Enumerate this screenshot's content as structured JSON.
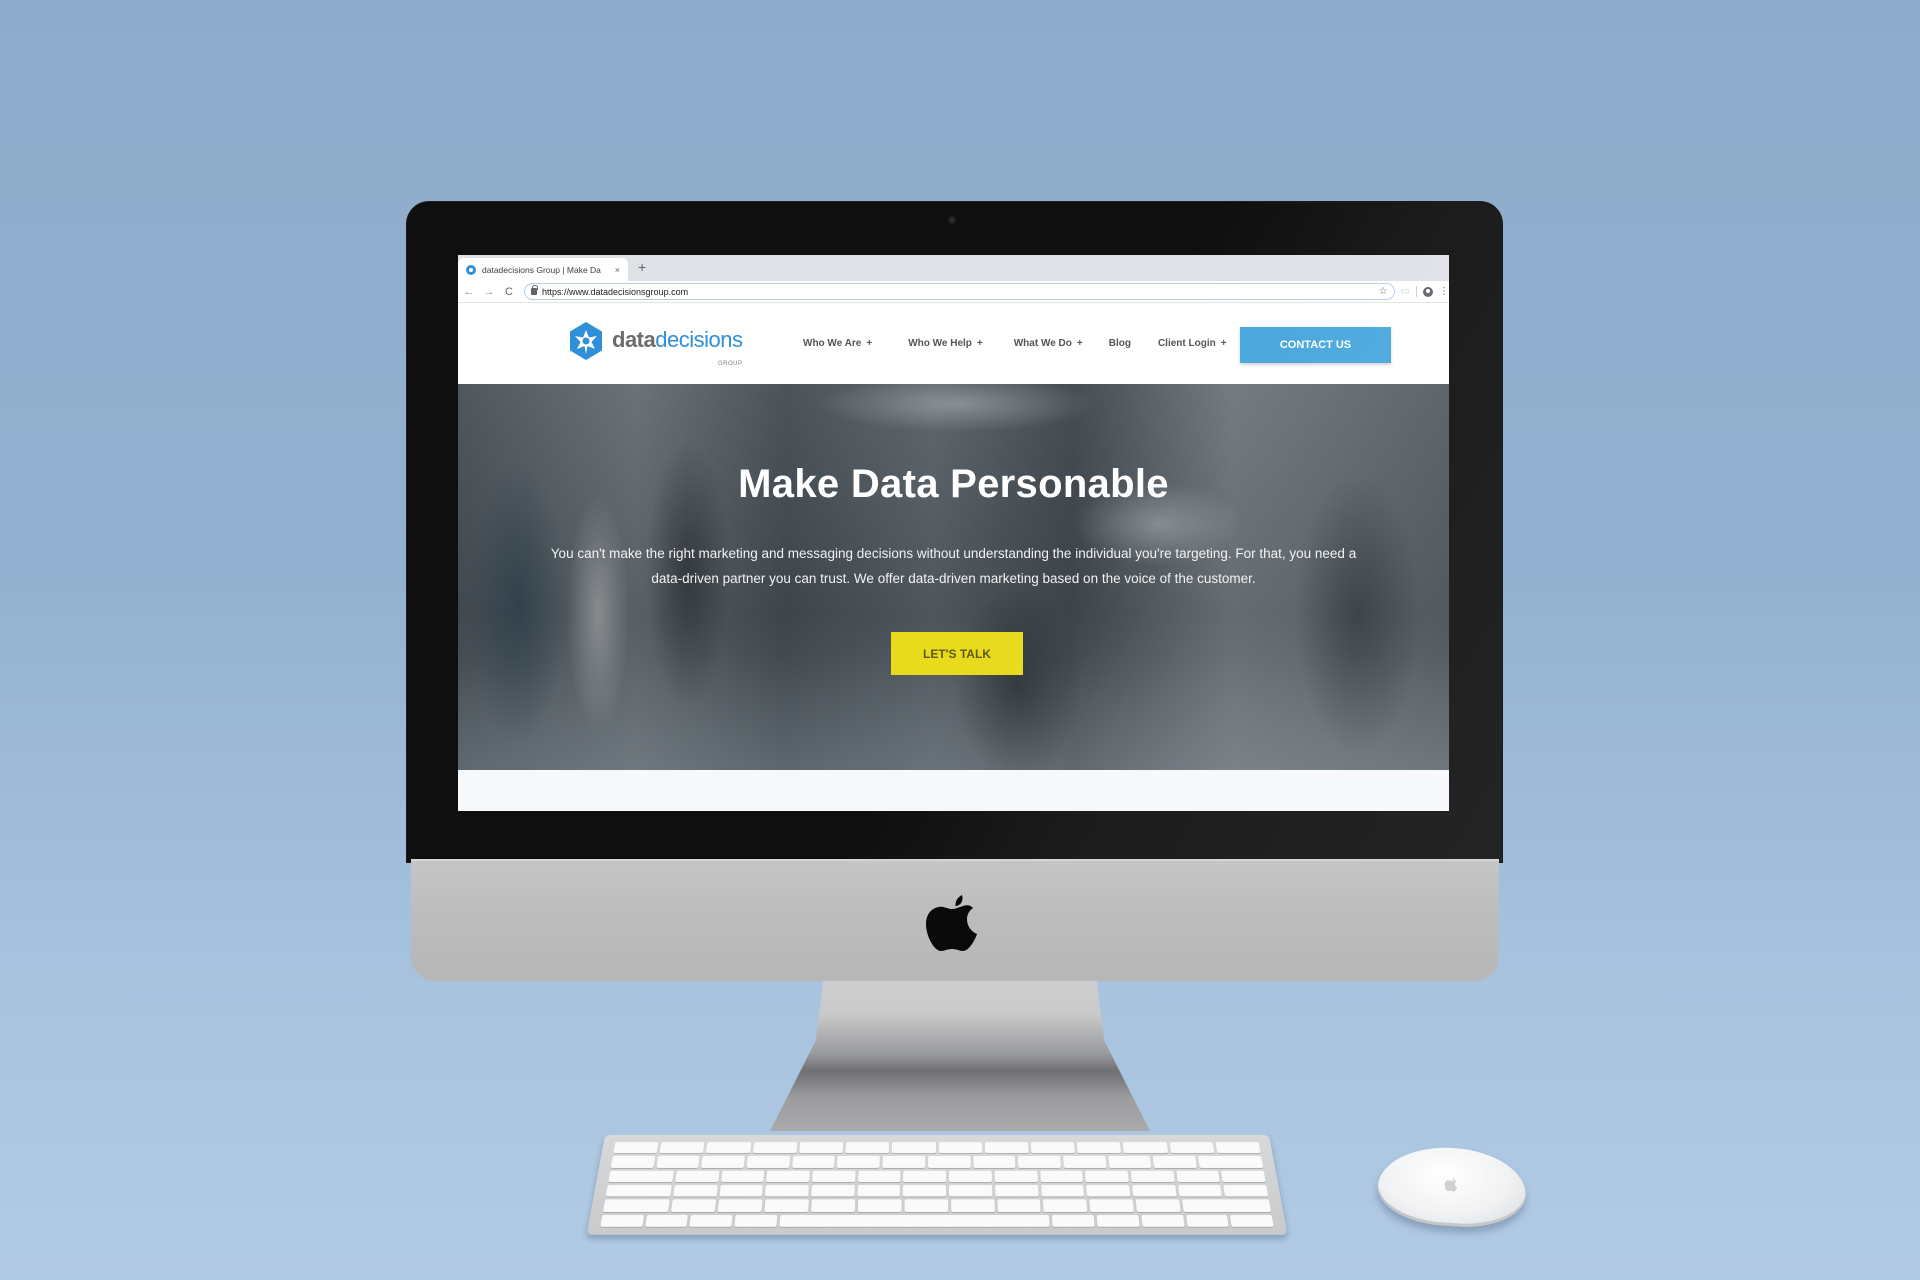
{
  "browser": {
    "tab_title": "datadecisions Group | Make Da",
    "tab_close": "×",
    "new_tab": "+",
    "back": "←",
    "forward": "→",
    "reload": "C",
    "url": "https://www.datadecisionsgroup.com",
    "bookmark_icon": "☆",
    "cast_icon": "▭",
    "menu_icon": "⋮"
  },
  "site": {
    "logo": {
      "data": "data",
      "decisions": "decisions",
      "group": "GROUP"
    },
    "nav": [
      {
        "label": "Who We Are",
        "expand": "+"
      },
      {
        "label": "Who We Help",
        "expand": "+"
      },
      {
        "label": "What We Do",
        "expand": "+"
      },
      {
        "label": "Blog",
        "expand": ""
      },
      {
        "label": "Client Login",
        "expand": "+"
      }
    ],
    "contact_label": "CONTACT US"
  },
  "hero": {
    "title_light": "Make Data ",
    "title_bold": "Personable",
    "description": "You can't make the right marketing and messaging decisions without understanding the individual you're targeting. For that, you need a data-driven partner you can trust. We offer data-driven marketing based on the voice of the customer.",
    "cta_label": "LET'S TALK"
  },
  "colors": {
    "brand_blue": "#2f8fd8",
    "contact_button": "#47a6dc",
    "cta_yellow": "#e8da1c",
    "backdrop": "#93b1d0"
  }
}
